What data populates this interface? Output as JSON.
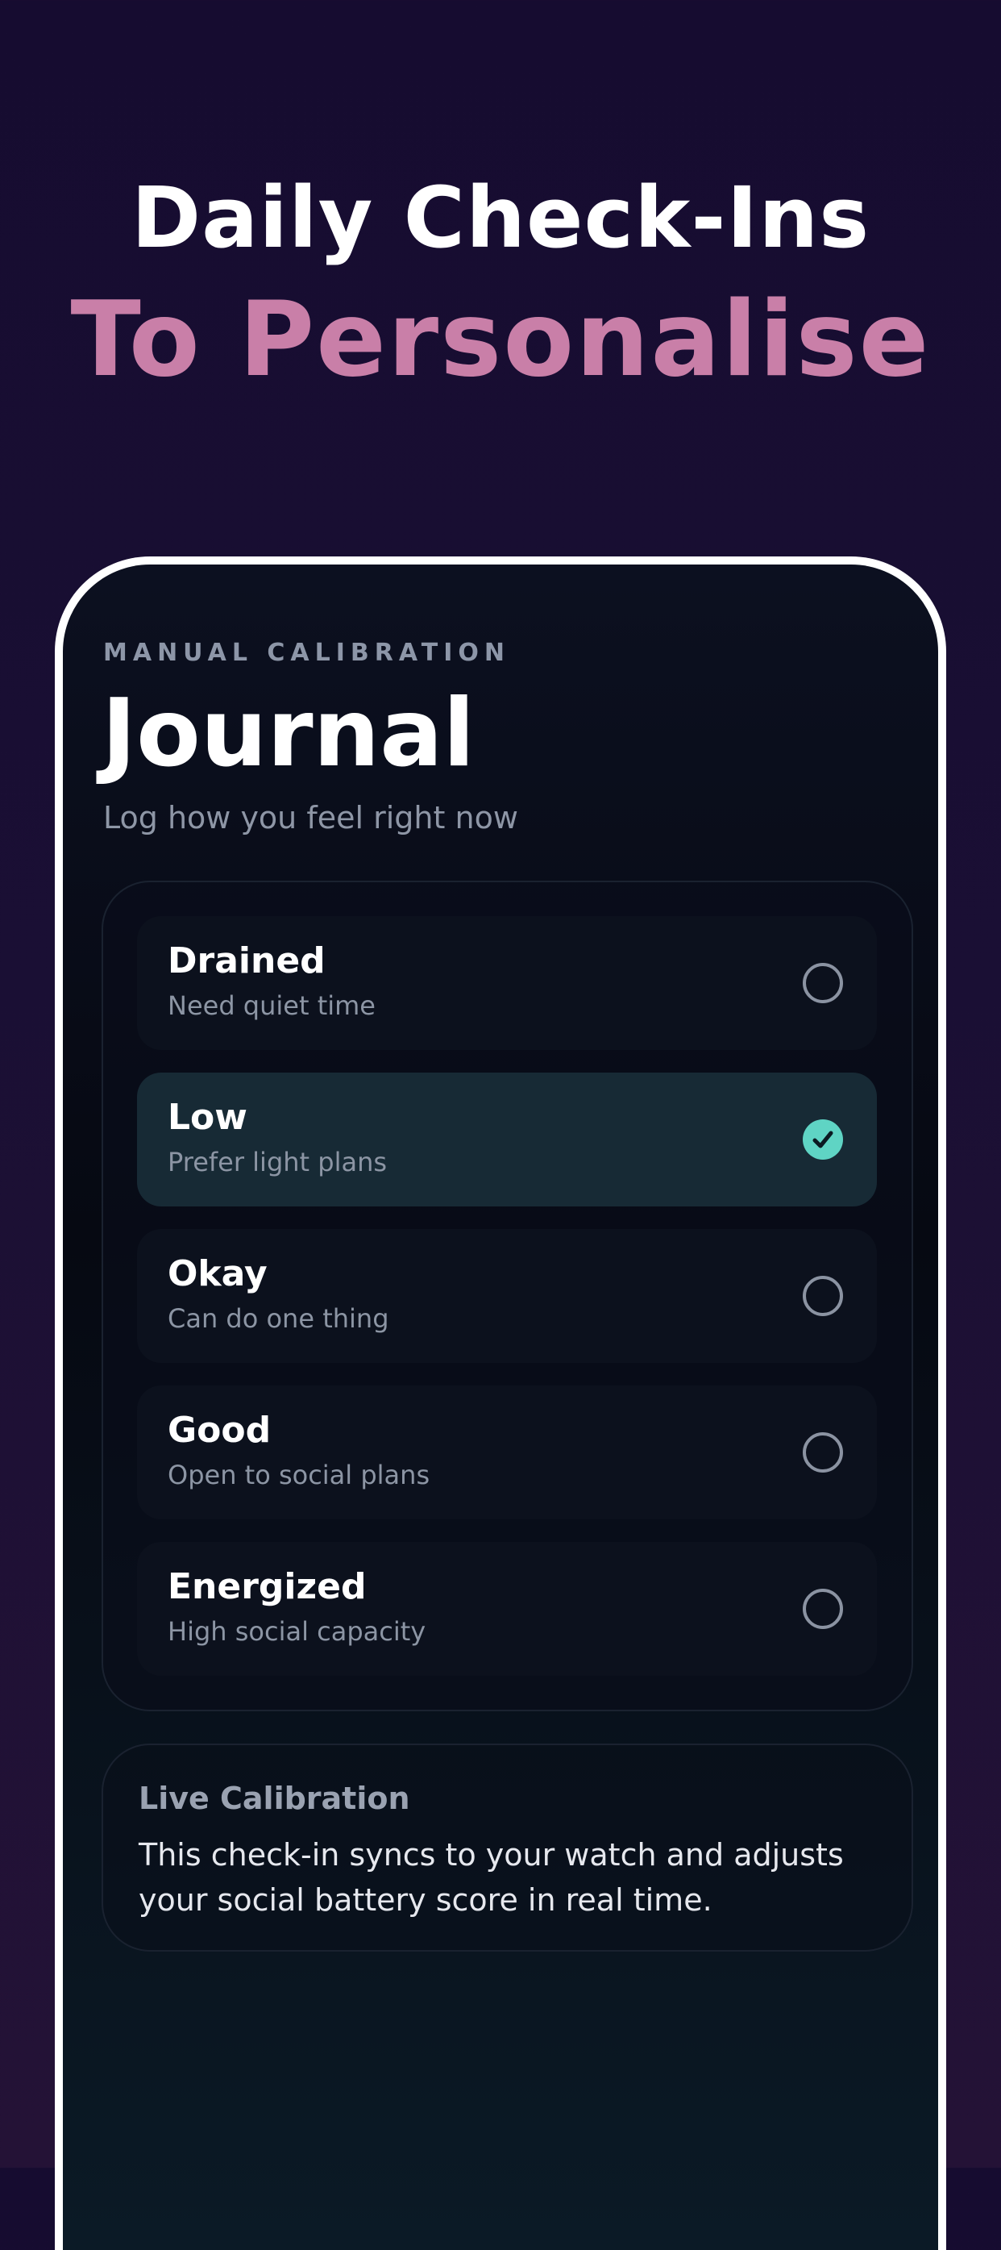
{
  "headline": {
    "line1": "Daily Check-Ins",
    "line2": "To Personalise"
  },
  "screen": {
    "eyebrow": "MANUAL CALIBRATION",
    "title": "Journal",
    "subtitle": "Log how you feel right now"
  },
  "options": [
    {
      "title": "Drained",
      "description": "Need quiet time",
      "selected": false
    },
    {
      "title": "Low",
      "description": "Prefer light plans",
      "selected": true
    },
    {
      "title": "Okay",
      "description": "Can do one thing",
      "selected": false
    },
    {
      "title": "Good",
      "description": "Open to social plans",
      "selected": false
    },
    {
      "title": "Energized",
      "description": "High social capacity",
      "selected": false
    }
  ],
  "live_calibration": {
    "title": "Live Calibration",
    "body": "This check-in syncs to your watch and adjusts your social battery score in real time."
  },
  "colors": {
    "accent": "#5fd4c4",
    "headline_pink": "#c97fa8",
    "background": "#160c30"
  },
  "icons": {
    "selected": "checkmark-circle-icon",
    "unselected": "radio-empty-icon"
  }
}
